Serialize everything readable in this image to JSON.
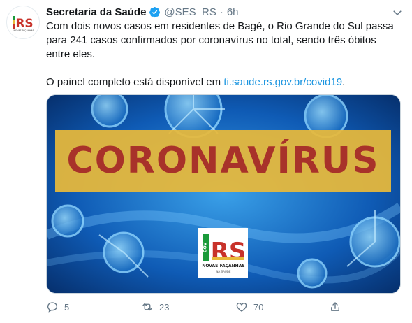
{
  "tweet": {
    "author_name": "Secretaria da Saúde",
    "handle": "@SES_RS",
    "separator": "·",
    "time": "6h",
    "text_line1": "Com dois novos casos em residentes de Bagé, o Rio Grande do Sul passa para 241 casos confirmados por coronavírus no total, sendo três óbitos entre eles.",
    "text_line2_prefix": "O painel completo está disponível em ",
    "link_text": "ti.saude.rs.gov.br/covid19",
    "text_line2_suffix": "."
  },
  "avatar": {
    "logo_text": "RS",
    "sub": "NOVAS FAÇANHAS"
  },
  "media": {
    "banner_text": "CORONAVÍRUS",
    "badge_logo": "RS",
    "badge_gov": "GOV",
    "badge_line1": "NOVAS FAÇANHAS",
    "badge_line2": "NA SAÚDE"
  },
  "actions": {
    "reply_count": "5",
    "retweet_count": "23",
    "like_count": "70"
  },
  "colors": {
    "link": "#1b95e0",
    "muted": "#657786",
    "banner": "#e8b93a",
    "banner_text": "#a8322a"
  }
}
